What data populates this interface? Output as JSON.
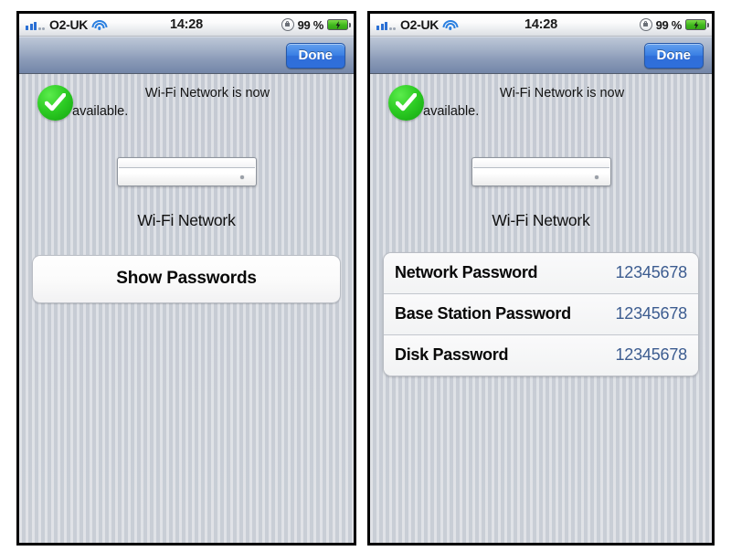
{
  "status_bar": {
    "carrier": "O2-UK",
    "time": "14:28",
    "battery_percent": "99 %",
    "signal_icon": "signal-bars-icon",
    "wifi_icon": "wifi-icon",
    "rotation_lock_icon": "rotation-lock-icon",
    "battery_icon": "battery-charging-icon"
  },
  "toolbar": {
    "done_label": "Done"
  },
  "panels": {
    "left": {
      "message": {
        "line1": "Wi-Fi Network is now",
        "line2": "available.",
        "status_icon": "green-check-icon"
      },
      "device_icon": "airport-base-station-icon",
      "network_name": "Wi-Fi Network",
      "show_passwords_label": "Show Passwords"
    },
    "right": {
      "message": {
        "line1": "Wi-Fi Network is now",
        "line2": "available.",
        "status_icon": "green-check-icon"
      },
      "device_icon": "airport-base-station-icon",
      "network_name": "Wi-Fi Network",
      "passwords": [
        {
          "label": "Network Password",
          "value": "12345678"
        },
        {
          "label": "Base Station Password",
          "value": "12345678"
        },
        {
          "label": "Disk Password",
          "value": "12345678"
        }
      ]
    }
  },
  "colors": {
    "accent_blue": "#2f6fdb",
    "password_value": "#3c5c90",
    "success_green": "#2ccb23",
    "screen_background": "#c9ced6"
  }
}
